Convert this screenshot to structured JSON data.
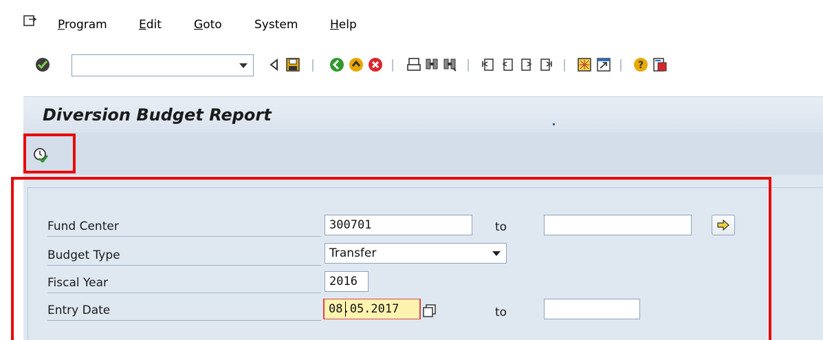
{
  "menu": {
    "items": [
      {
        "label": "Program"
      },
      {
        "label": "Edit"
      },
      {
        "label": "Goto"
      },
      {
        "label": "System"
      },
      {
        "label": "Help"
      }
    ]
  },
  "toolbar": {
    "command_value": "",
    "icons": [
      "enter-checkmark-icon",
      "back-triangle-icon",
      "save-icon",
      "back-icon",
      "exit-icon",
      "cancel-icon",
      "print-icon",
      "find-icon",
      "find-next-icon",
      "first-page-icon",
      "previous-page-icon",
      "next-page-icon",
      "last-page-icon",
      "create-session-icon",
      "shortcut-icon",
      "help-icon",
      "customize-layout-icon"
    ]
  },
  "screen": {
    "title": "Diversion Budget Report",
    "execute_icon": "execute-clock-icon"
  },
  "form": {
    "fund_center": {
      "label": "Fund Center",
      "from": "300701",
      "to_label": "to",
      "to": ""
    },
    "budget_type": {
      "label": "Budget Type",
      "value": "Transfer"
    },
    "fiscal_year": {
      "label": "Fiscal Year",
      "value": "2016"
    },
    "entry_date": {
      "label": "Entry Date",
      "from": "08.05.2017",
      "to_label": "to",
      "to": ""
    }
  },
  "colors": {
    "highlight": "#e8090a",
    "panel": "#dfe8f1",
    "field_focus": "#fff3b0"
  }
}
